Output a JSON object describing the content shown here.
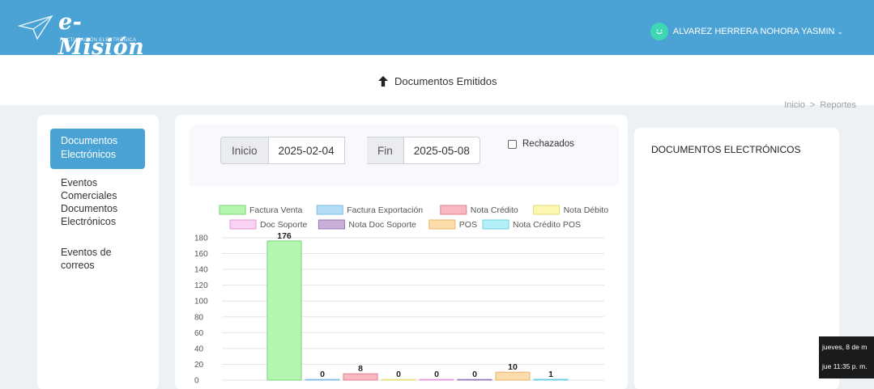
{
  "header": {
    "logo_title": "e-Misión",
    "logo_subtitle": "FACTURACIÓN ELECTRÓNICA",
    "user_name": "ALVAREZ HERRERA NOHORA YASMIN",
    "user_caret": "⌄"
  },
  "subheader": {
    "title": "Documentos Emitidos",
    "breadcrumb": [
      "Inicio",
      ">",
      "Reportes"
    ]
  },
  "sidebar": {
    "items": [
      {
        "label_line1": "Documentos",
        "label_line2": "Electrónicos",
        "active": true
      },
      {
        "label_lines": [
          "Eventos",
          "Comerciales",
          "Documentos",
          "Electrónicos"
        ],
        "active": false
      },
      {
        "label_lines": [
          "Eventos de",
          "correos"
        ],
        "active": false
      }
    ]
  },
  "filters": {
    "start_label": "Inicio",
    "start_value": "2025-02-04",
    "end_label": "Fin",
    "end_value": "2025-05-08",
    "rejected_label": "Rechazados",
    "rejected_checked": false
  },
  "right_panel": {
    "title": "DOCUMENTOS ELECTRÓNICOS"
  },
  "taskbar_tooltip": {
    "line1": "jueves, 8 de m",
    "line2": "jue 11:35 p. m."
  },
  "colors": {
    "header": "#4aa3d4",
    "active_menu": "#4aa3d4",
    "avatar": "#3fd6b4"
  },
  "chart_data": {
    "type": "bar",
    "categories": [
      "Factura Venta",
      "Factura Exportación",
      "Nota Crédito",
      "Nota Débito",
      "Doc Soporte",
      "Nota Doc Soporte",
      "POS",
      "Nota Crédito POS"
    ],
    "values": [
      176,
      0,
      8,
      0,
      0,
      0,
      10,
      1
    ],
    "legend": [
      {
        "name": "Factura Venta",
        "fill": "#b4f5b0",
        "stroke": "#7ad676"
      },
      {
        "name": "Factura Exportación",
        "fill": "#b5dcf5",
        "stroke": "#7bbde6"
      },
      {
        "name": "Nota Crédito",
        "fill": "#f7b8c2",
        "stroke": "#e0808f"
      },
      {
        "name": "Nota Débito",
        "fill": "#fbf7b3",
        "stroke": "#e6dd7a"
      },
      {
        "name": "Doc Soporte",
        "fill": "#f8d3f2",
        "stroke": "#e59ad9"
      },
      {
        "name": "Nota Doc Soporte",
        "fill": "#c8b0d8",
        "stroke": "#9a77b6"
      },
      {
        "name": "POS",
        "fill": "#fbdcaa",
        "stroke": "#e8b66a"
      },
      {
        "name": "Nota Crédito POS",
        "fill": "#b4eef7",
        "stroke": "#6fd0e3"
      }
    ],
    "ylim": [
      0,
      180
    ],
    "y_ticks": [
      0,
      20,
      40,
      60,
      80,
      100,
      120,
      140,
      160,
      180
    ],
    "legend_position": "top",
    "grid": true
  }
}
